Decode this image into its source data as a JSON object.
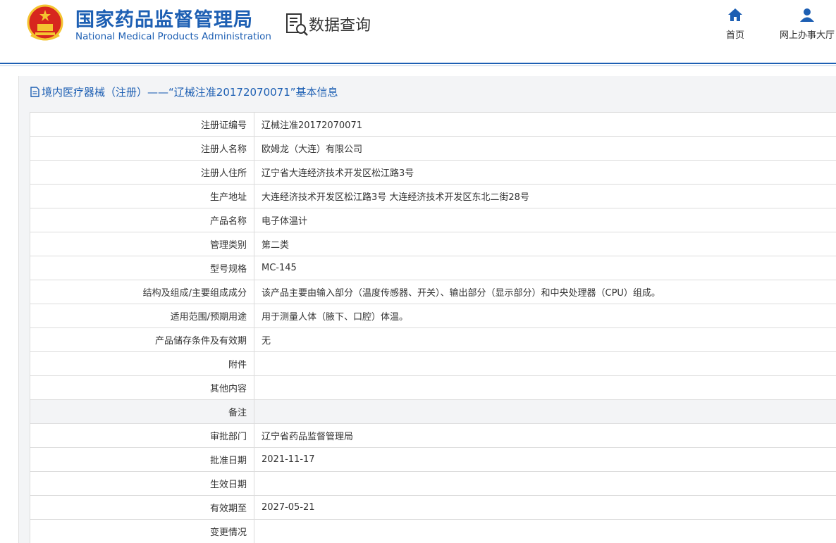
{
  "header": {
    "logo_cn": "国家药品监督管理局",
    "logo_en": "National Medical Products Administration",
    "section_title": "数据查询",
    "nav": [
      {
        "label": "首页",
        "icon": "home-icon"
      },
      {
        "label": "网上办事大厅",
        "icon": "user-icon"
      }
    ]
  },
  "colors": {
    "brand": "#1d5fb3",
    "emblem_red": "#d7261e",
    "emblem_gold": "#f4c430"
  },
  "panel": {
    "title": "境内医疗器械（注册）——“辽械注准20172070071”基本信息"
  },
  "rows": [
    {
      "label": "注册证编号",
      "value": "辽械注准20172070071"
    },
    {
      "label": "注册人名称",
      "value": "欧姆龙（大连）有限公司"
    },
    {
      "label": "注册人住所",
      "value": "辽宁省大连经济技术开发区松江路3号"
    },
    {
      "label": "生产地址",
      "value": "大连经济技术开发区松江路3号 大连经济技术开发区东北二街28号"
    },
    {
      "label": "产品名称",
      "value": "电子体温计"
    },
    {
      "label": "管理类别",
      "value": "第二类"
    },
    {
      "label": "型号规格",
      "value": "MC-145"
    },
    {
      "label": "结构及组成/主要组成成分",
      "value": "该产品主要由输入部分（温度传感器、开关）、输出部分（显示部分）和中央处理器（CPU）组成。"
    },
    {
      "label": "适用范围/预期用途",
      "value": "用于测量人体（腋下、口腔）体温。"
    },
    {
      "label": "产品储存条件及有效期",
      "value": "无"
    },
    {
      "label": "附件",
      "value": ""
    },
    {
      "label": "其他内容",
      "value": ""
    },
    {
      "label": "备注",
      "value": ""
    },
    {
      "label": "审批部门",
      "value": "辽宁省药品监督管理局"
    },
    {
      "label": "批准日期",
      "value": "2021-11-17"
    },
    {
      "label": "生效日期",
      "value": ""
    },
    {
      "label": "有效期至",
      "value": "2027-05-21"
    },
    {
      "label": "变更情况",
      "value": ""
    }
  ]
}
